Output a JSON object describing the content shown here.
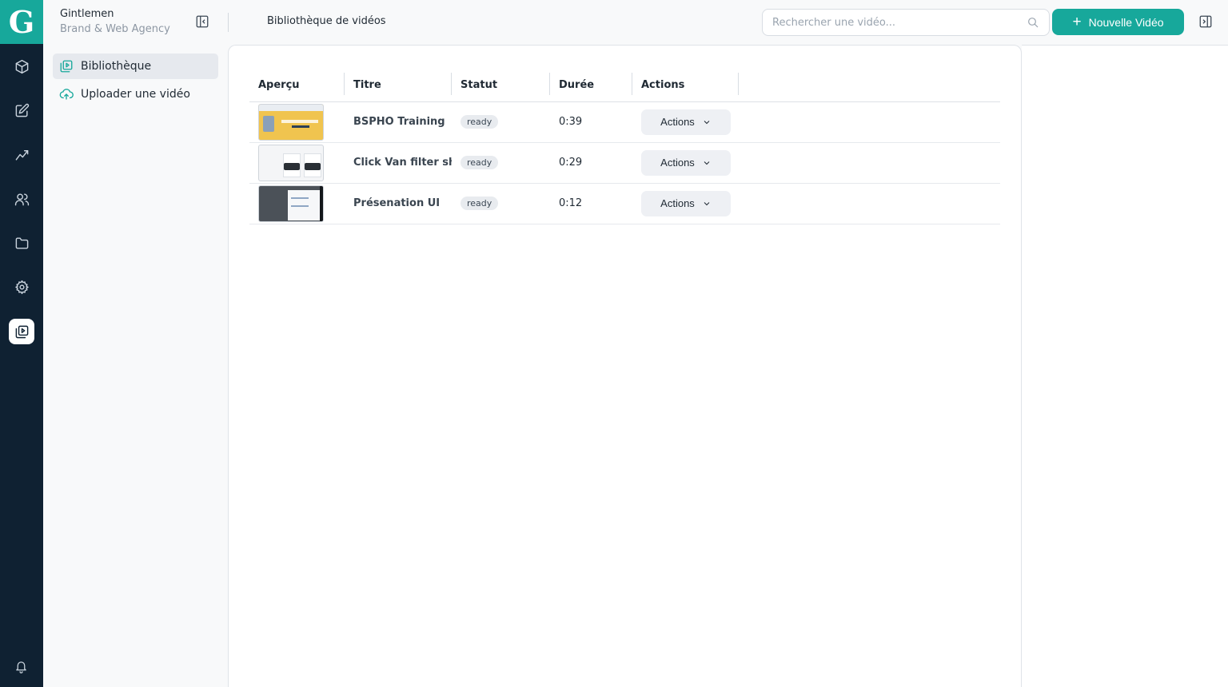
{
  "brand": {
    "logo_letter": "G",
    "name": "Gintlemen",
    "tagline": "Brand & Web Agency"
  },
  "rail": {
    "icons": [
      "cube-icon",
      "edit-icon",
      "chart-line-icon",
      "users-icon",
      "folder-icon",
      "gear-icon",
      "video-library-icon"
    ],
    "active": "video-library-icon",
    "bottom_icon": "bell-icon"
  },
  "subnav": {
    "items": [
      {
        "label": "Bibliothèque",
        "icon": "video-library-icon",
        "active": true
      },
      {
        "label": "Uploader une vidéo",
        "icon": "cloud-upload-icon",
        "active": false
      }
    ]
  },
  "header": {
    "title": "Bibliothèque de vidéos",
    "search_placeholder": "Rechercher une vidéo...",
    "new_button": "Nouvelle Vidéo"
  },
  "table": {
    "columns": [
      "Aperçu",
      "Titre",
      "Statut",
      "Durée",
      "Actions"
    ],
    "rows": [
      {
        "title": "BSPHO Training",
        "status": "ready",
        "duration": "0:39",
        "action": "Actions"
      },
      {
        "title": "Click Van filter sho",
        "status": "ready",
        "duration": "0:29",
        "action": "Actions"
      },
      {
        "title": "Présenation UI",
        "status": "ready",
        "duration": "0:12",
        "action": "Actions"
      }
    ]
  },
  "colors": {
    "accent": "#17a89b",
    "rail_bg": "#0f2132"
  }
}
